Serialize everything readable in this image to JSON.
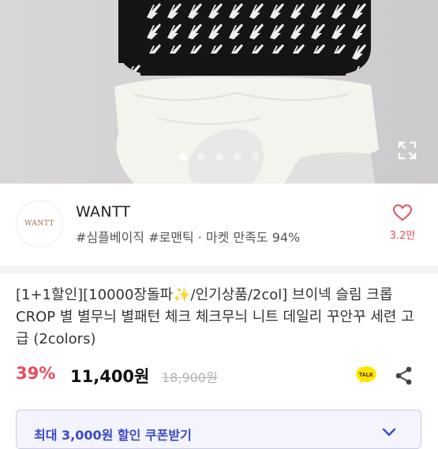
{
  "gallery": {
    "slide_count": 5,
    "active_index": 0,
    "expand_icon": "expand-icon"
  },
  "shop": {
    "name": "WANTT",
    "logo_text": "WANTT",
    "tags": "#심플베이직 #로맨틱 · 마켓 만족도 94%",
    "like_count": "3.2만",
    "like_icon": "heart-icon"
  },
  "product": {
    "title_part1": "[1+1할인][10000장돌파",
    "sparkle": "✨",
    "title_part2": "/인기상품/2col] 브이넥 슬림 크롭 CROP 별 별무늬 별패턴 체크 체크무늬 니트 데일리 꾸안꾸 세련 고급 (2colors)",
    "discount": "39%",
    "price": "11,400원",
    "original_price": "18,900원"
  },
  "coupon": {
    "label": "최대 3,000원 할인 쿠폰받기"
  },
  "colors": {
    "accent_red": "#e84c5b",
    "coupon_blue": "#3949c6",
    "kakao_yellow": "#fee500"
  }
}
